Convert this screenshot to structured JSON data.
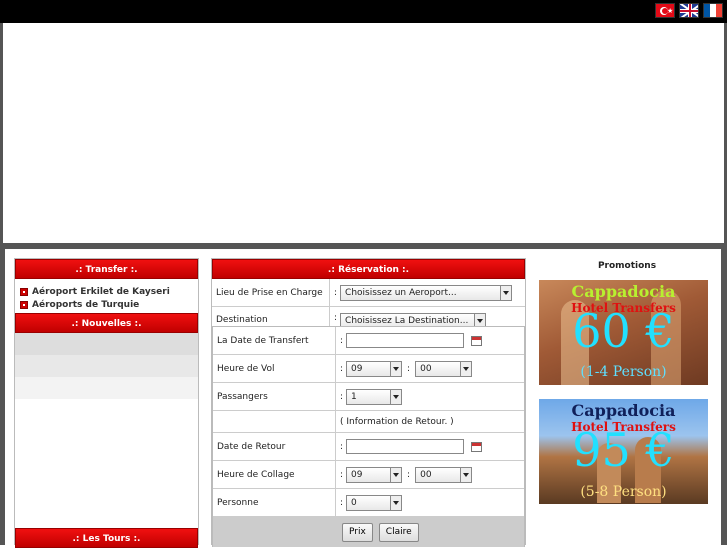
{
  "languages": [
    {
      "name": "Türkçe",
      "icon": "turkey-flag-icon"
    },
    {
      "name": "English",
      "icon": "uk-flag-icon"
    },
    {
      "name": "Français",
      "icon": "france-flag-icon"
    }
  ],
  "sidebar": {
    "transfer_title": ".: Transfer :.",
    "transfer_links": [
      "Aéroport Erkilet de Kayseri",
      "Aéroports de Turquie"
    ],
    "news_title": ".: Nouvelles :.",
    "tours_title": ".: Les Tours :."
  },
  "reservation": {
    "title": ".: Réservation :.",
    "pickup_label": "Lieu de Prise en Charge",
    "pickup_value": "Choisissez un Aeroport...",
    "destination_label": "Destination",
    "destination_value": "Choisissez La Destination...",
    "transfer_date_label": "La Date de Transfert",
    "flight_time_label": "Heure de Vol",
    "flight_hour": "09",
    "flight_minute": "00",
    "passengers_label": "Passangers",
    "passengers_value": "1",
    "return_info": "( Information de Retour. )",
    "return_date_label": "Date de Retour",
    "pickup_time_label": "Heure de Collage",
    "pickup_hour": "09",
    "pickup_minute": "00",
    "persons_label": "Personne",
    "persons_value": "0",
    "colon": ":",
    "price_button": "Prix",
    "clear_button": "Claire"
  },
  "promotions": {
    "title": "Promotions",
    "items": [
      {
        "title": "Cappadocia",
        "subtitle": "Hotel Transfers",
        "price": "60 €",
        "persons": "(1-4 Person)"
      },
      {
        "title": "Cappadocia",
        "subtitle": "Hotel Transfers",
        "price": "95 €",
        "persons": "(5-8 Person)"
      }
    ]
  },
  "colors": {
    "accent_red": "#e00000",
    "frame_gray": "#555555",
    "promo_cyan": "#22e0ff"
  }
}
